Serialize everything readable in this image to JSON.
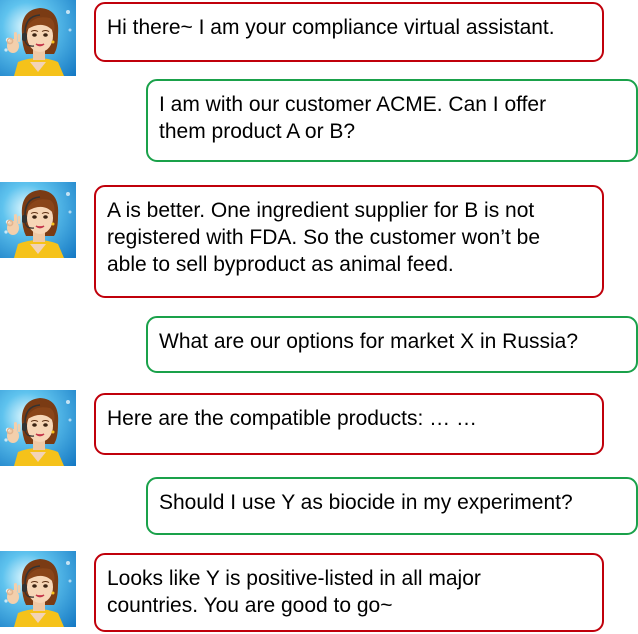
{
  "colors": {
    "assistant_border": "#c0000b",
    "user_border": "#1aa14a"
  },
  "conversation": {
    "messages": [
      {
        "speaker": "assistant",
        "text": "Hi there~ I am your compliance virtual assistant."
      },
      {
        "speaker": "user",
        "text": "I am with our customer ACME. Can I offer\nthem product A or B?"
      },
      {
        "speaker": "assistant",
        "text": "A is better. One ingredient supplier for B is not\nregistered with FDA. So the customer won’t be\nable to sell byproduct as animal feed."
      },
      {
        "speaker": "user",
        "text": "What are our options for market X in Russia?"
      },
      {
        "speaker": "assistant",
        "text": "Here are the compatible products: … …"
      },
      {
        "speaker": "user",
        "text": "Should I use Y as biocide in my experiment?"
      },
      {
        "speaker": "assistant",
        "text": "Looks like Y is positive-listed in all major\ncountries. You are good to go~"
      }
    ]
  }
}
